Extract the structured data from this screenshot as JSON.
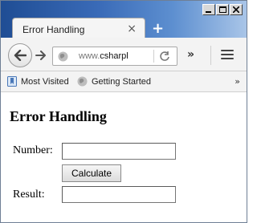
{
  "browser": {
    "tab_title": "Error Handling",
    "tab_close_glyph": "×",
    "new_tab_glyph": "+",
    "url_prefix": "www.",
    "url_domain": "csharpl",
    "overflow_glyph": "»",
    "bookmarks_overflow_glyph": "»",
    "bookmarks": [
      {
        "label": "Most Visited",
        "icon": "bookmarks-icon"
      },
      {
        "label": "Getting Started",
        "icon": "globe-icon"
      }
    ]
  },
  "page": {
    "heading": "Error Handling",
    "number_label": "Number:",
    "number_value": "",
    "calculate_label": "Calculate",
    "result_label": "Result:",
    "result_value": ""
  },
  "colors": {
    "titlebar_accent": "#2f5fa8",
    "toolbar_bg": "#f3f3f3",
    "field_border": "#767676"
  }
}
